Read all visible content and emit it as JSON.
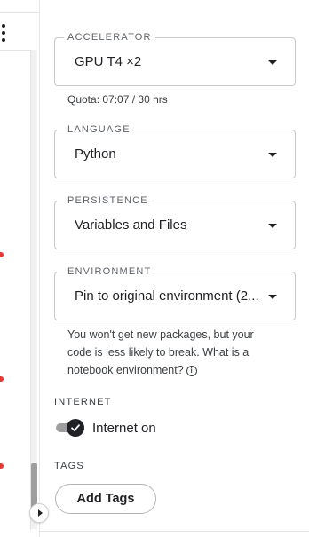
{
  "panel": {
    "accelerator": {
      "label": "ACCELERATOR",
      "value": "GPU T4 ×2",
      "quota": "Quota: 07:07 / 30 hrs"
    },
    "language": {
      "label": "LANGUAGE",
      "value": "Python"
    },
    "persistence": {
      "label": "PERSISTENCE",
      "value": "Variables and Files"
    },
    "environment": {
      "label": "ENVIRONMENT",
      "value": "Pin to original environment (2...",
      "helper_line1": "You won't get new packages, but your",
      "helper_line2": "code is less likely to break. What is a",
      "helper_line3": "notebook environment?"
    },
    "internet": {
      "label": "INTERNET",
      "toggle_label": "Internet on",
      "enabled": true
    },
    "tags": {
      "label": "TAGS",
      "button_label": "Add Tags"
    }
  },
  "icons": {
    "more": "kebab-menu-icon",
    "dropdown": "caret-down-icon",
    "info": "info-icon",
    "check": "check-icon",
    "expand": "play-arrow-icon"
  },
  "colors": {
    "accent": "#202124",
    "border": "#c9c9c9",
    "error_marker": "#e53935"
  }
}
